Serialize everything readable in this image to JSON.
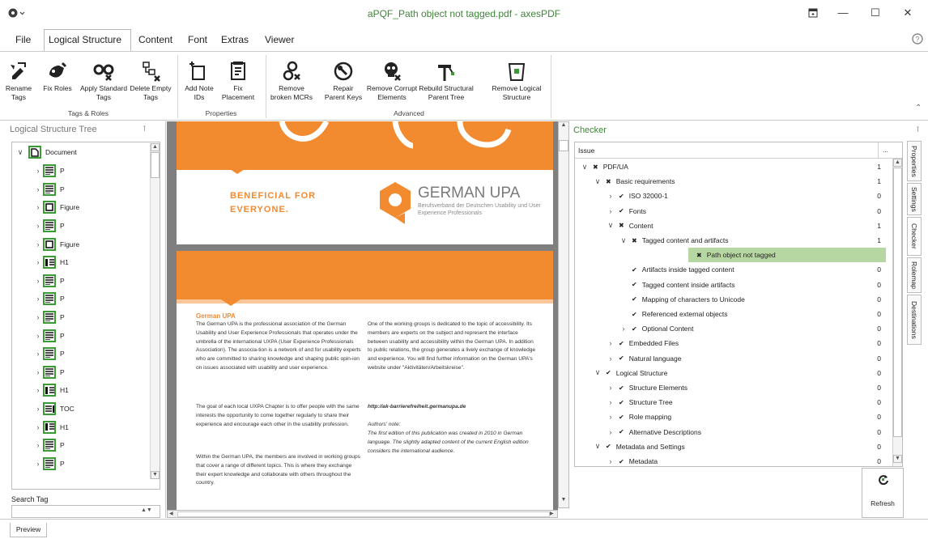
{
  "window": {
    "title": "aPQF_Path object not tagged.pdf - axesPDF",
    "app_icon": "gear-icon",
    "controls": [
      "minimize",
      "maximize",
      "close"
    ]
  },
  "menu": {
    "items": [
      "File",
      "Logical Structure",
      "Content",
      "Font",
      "Extras",
      "Viewer"
    ]
  },
  "ribbon": {
    "tags_roles": {
      "label": "Tags & Roles",
      "buttons": [
        {
          "label": "Rename Tags",
          "icon": "rename-tags-icon"
        },
        {
          "label": "Fix Roles",
          "icon": "fix-roles-icon"
        },
        {
          "label": "Apply Standard Tags",
          "icon": "apply-standard-tags-icon"
        },
        {
          "label": "Delete Empty Tags",
          "icon": "delete-empty-tags-icon"
        }
      ]
    },
    "properties": {
      "label": "Properties",
      "buttons": [
        {
          "label": "Add Note IDs",
          "icon": "add-note-ids-icon"
        },
        {
          "label": "Fix Placement",
          "icon": "fix-placement-icon"
        }
      ]
    },
    "advanced": {
      "label": "Advanced",
      "buttons": [
        {
          "label": "Remove broken MCRs",
          "icon": "remove-broken-mcrs-icon"
        },
        {
          "label": "Repair Parent Keys",
          "icon": "repair-parent-keys-icon"
        },
        {
          "label": "Remove Corrupt Elements",
          "icon": "remove-corrupt-elements-icon"
        },
        {
          "label": "Rebuild Structural Parent Tree",
          "icon": "rebuild-parent-tree-icon"
        },
        {
          "label": "Remove Logical Structure",
          "icon": "remove-logical-structure-icon"
        }
      ]
    }
  },
  "left_panel": {
    "title": "Logical Structure Tree",
    "pin": "pin-icon",
    "root": "Document",
    "items": [
      "P",
      "P",
      "Figure",
      "P",
      "Figure",
      "H1",
      "P",
      "P",
      "P",
      "P",
      "P",
      "P",
      "H1",
      "TOC",
      "H1",
      "P",
      "P"
    ],
    "search_label": "Search Tag",
    "search_value": ""
  },
  "document": {
    "beneficial": "BENEFICIAL FOR EVERYONE.",
    "logo_name": "GERMAN UPA",
    "logo_sub": "Berufsverband der Deutschen Usability und User Experience Professionals",
    "heading": "German UPA",
    "col1": "The German UPA is the professional association of the German Usability and User Experience Professionals that operates under the umbrella of the international UXPA (User Experience Professionals Association). The associa-tion is a network of and for usability experts who are committed to sharing knowledge and shaping public opin-ion on issues associated with usability and user experience.",
    "col1b": "The goal of each local UXPA Chapter is to offer people with the same interests the opportunity to come together regularly to share their experience and encourage each other in the usability profession.",
    "col1c": "Within the German UPA, the members are involved in working groups that cover a range of different topics. This is where they exchange their expert knowledge and collaborate with others throughout the country.",
    "col2": "One of the working groups is dedicated to the topic of accessibility. Its members are experts on the subject and represent the interface between usability and accessibility within the German UPA. In addition to public relations, the group generates a lively exchange of knowledge and experience. You will find further information on the German UPA's website under \"Aktivitäten/Arbeitskreise\".",
    "url": "http://ak-barrierefreiheit.germanupa.de",
    "note_title": "Authors' note:",
    "note": "The first edition of this publication was created in 2010 in German language. The slightly adapted content of the current English edition considers the international audience."
  },
  "checker": {
    "title": "Checker",
    "header_issue": "Issue",
    "header_more": "...",
    "rows": [
      {
        "label": "PDF/UA",
        "count": "1",
        "status": "fail",
        "level": 0,
        "expanded": true
      },
      {
        "label": "Basic requirements",
        "count": "1",
        "status": "fail",
        "level": 1,
        "expanded": true
      },
      {
        "label": "ISO 32000-1",
        "count": "0",
        "status": "pass",
        "level": 2,
        "expanded": false
      },
      {
        "label": "Fonts",
        "count": "0",
        "status": "pass",
        "level": 2,
        "expanded": false
      },
      {
        "label": "Content",
        "count": "1",
        "status": "fail",
        "level": 2,
        "expanded": true
      },
      {
        "label": "Tagged content and artifacts",
        "count": "1",
        "status": "fail",
        "level": 3,
        "expanded": true
      },
      {
        "label": "Path object not tagged",
        "count": "",
        "status": "fail",
        "level": 4,
        "selected": true
      },
      {
        "label": "Artifacts inside tagged content",
        "count": "0",
        "status": "pass",
        "level": 3
      },
      {
        "label": "Tagged content inside artifacts",
        "count": "0",
        "status": "pass",
        "level": 3
      },
      {
        "label": "Mapping of characters to Unicode",
        "count": "0",
        "status": "pass",
        "level": 3
      },
      {
        "label": "Referenced external objects",
        "count": "0",
        "status": "pass",
        "level": 3
      },
      {
        "label": "Optional Content",
        "count": "0",
        "status": "pass",
        "level": 3,
        "expanded": false
      },
      {
        "label": "Embedded Files",
        "count": "0",
        "status": "pass",
        "level": 2,
        "expanded": false
      },
      {
        "label": "Natural language",
        "count": "0",
        "status": "pass",
        "level": 2,
        "expanded": false
      },
      {
        "label": "Logical Structure",
        "count": "0",
        "status": "pass",
        "level": 1,
        "expanded": true
      },
      {
        "label": "Structure Elements",
        "count": "0",
        "status": "pass",
        "level": 2,
        "expanded": false
      },
      {
        "label": "Structure Tree",
        "count": "0",
        "status": "pass",
        "level": 2,
        "expanded": false
      },
      {
        "label": "Role mapping",
        "count": "0",
        "status": "pass",
        "level": 2,
        "expanded": false
      },
      {
        "label": "Alternative Descriptions",
        "count": "0",
        "status": "pass",
        "level": 2,
        "expanded": false
      },
      {
        "label": "Metadata and Settings",
        "count": "0",
        "status": "pass",
        "level": 1,
        "expanded": true
      },
      {
        "label": "Metadata",
        "count": "0",
        "status": "pass",
        "level": 2,
        "expanded": false
      }
    ],
    "refresh": "Refresh"
  },
  "side_tabs": [
    "Properties",
    "Settings",
    "Checker",
    "Rolemap",
    "Destinations"
  ],
  "bottom": {
    "tab": "Preview"
  },
  "colors": {
    "accent": "#40843a",
    "node_border": "#3a9a33",
    "orange": "#f28a30",
    "selected_row": "#b7d7a2"
  }
}
